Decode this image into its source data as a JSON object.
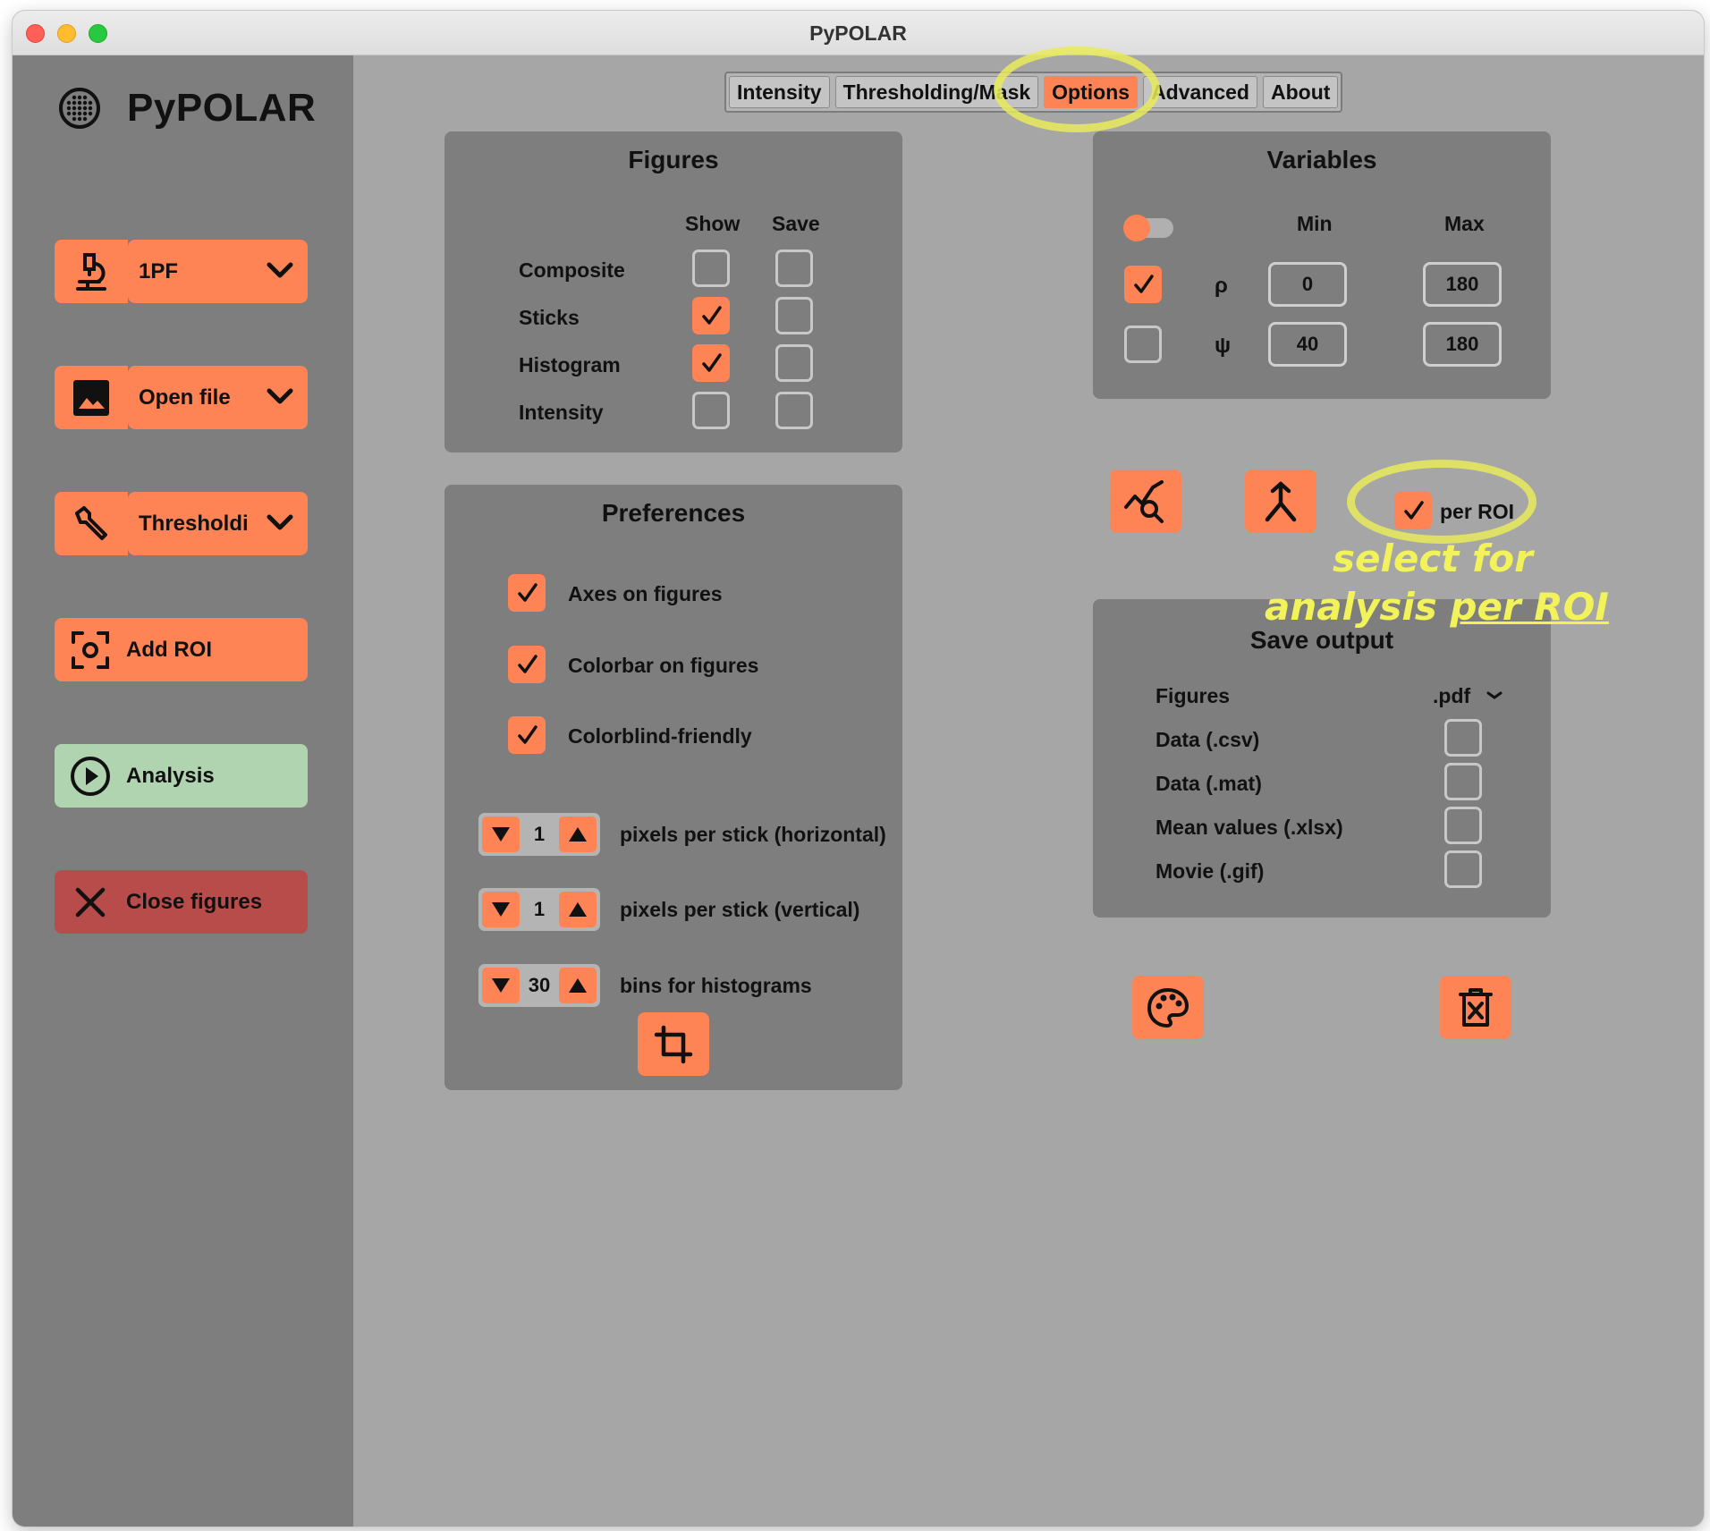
{
  "window": {
    "title": "PyPOLAR"
  },
  "app": {
    "name": "PyPOLAR"
  },
  "sidebar": {
    "mode_label": "1PF",
    "open_file_label": "Open file",
    "thresholding_label": "Thresholdi",
    "add_roi_label": "Add ROI",
    "analysis_label": "Analysis",
    "close_figures_label": "Close figures"
  },
  "tabs": [
    {
      "label": "Intensity",
      "active": false
    },
    {
      "label": "Thresholding/Mask",
      "active": false
    },
    {
      "label": "Options",
      "active": true
    },
    {
      "label": "Advanced",
      "active": false
    },
    {
      "label": "About",
      "active": false
    }
  ],
  "figures": {
    "title": "Figures",
    "col_show": "Show",
    "col_save": "Save",
    "rows": [
      {
        "label": "Composite",
        "show": false,
        "save": false
      },
      {
        "label": "Sticks",
        "show": true,
        "save": false
      },
      {
        "label": "Histogram",
        "show": true,
        "save": false
      },
      {
        "label": "Intensity",
        "show": false,
        "save": false
      }
    ]
  },
  "preferences": {
    "title": "Preferences",
    "checks": [
      {
        "label": "Axes on figures",
        "checked": true
      },
      {
        "label": "Colorbar on figures",
        "checked": true
      },
      {
        "label": "Colorblind-friendly",
        "checked": true
      }
    ],
    "spinners": [
      {
        "value": "1",
        "label": "pixels per stick (horizontal)"
      },
      {
        "value": "1",
        "label": "pixels per stick (vertical)"
      },
      {
        "value": "30",
        "label": "bins for histograms"
      }
    ]
  },
  "variables": {
    "title": "Variables",
    "col_min": "Min",
    "col_max": "Max",
    "rows": [
      {
        "symbol": "ρ",
        "checked": true,
        "min": "0",
        "max": "180"
      },
      {
        "symbol": "ψ",
        "checked": false,
        "min": "40",
        "max": "180"
      }
    ]
  },
  "per_roi": {
    "label": "per ROI",
    "checked": true
  },
  "annotation": {
    "line1": "select for",
    "line2_a": "analysis ",
    "line2_b": "per ROI"
  },
  "save_output": {
    "title": "Save output",
    "figures_label": "Figures",
    "figures_format": ".pdf",
    "items": [
      {
        "label": "Data (.csv)",
        "checked": false
      },
      {
        "label": "Data (.mat)",
        "checked": false
      },
      {
        "label": "Mean values (.xlsx)",
        "checked": false
      },
      {
        "label": "Movie (.gif)",
        "checked": false
      }
    ]
  },
  "colors": {
    "accent": "#fe8355",
    "analysis": "#b0d3b0",
    "close": "#b84c4a",
    "highlight": "#e8eb5a"
  }
}
